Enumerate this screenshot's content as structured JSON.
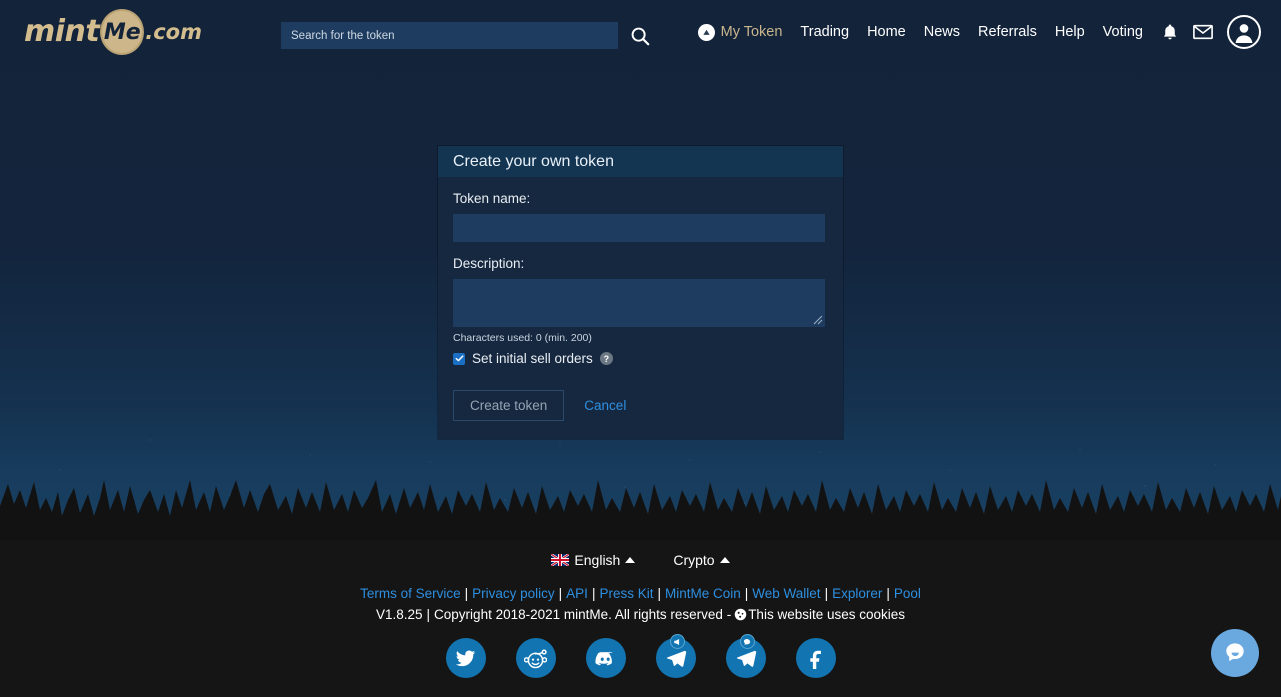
{
  "brand": {
    "logo_prefix": "mint",
    "logo_coin": "Me",
    "logo_suffix": ".com",
    "accent_gold": "#d3bd8e",
    "accent_blue": "#2e8fe0",
    "navbar_bg": "#13233a",
    "footer_bg": "#151515"
  },
  "search": {
    "placeholder": "Search for the token",
    "value": "",
    "icon": "search-icon"
  },
  "nav": {
    "my_token": "My Token",
    "my_token_icon": "triangle-up-circle-icon",
    "links": [
      {
        "label": "Trading"
      },
      {
        "label": "Home"
      },
      {
        "label": "News"
      },
      {
        "label": "Referrals"
      },
      {
        "label": "Help"
      },
      {
        "label": "Voting"
      }
    ],
    "icons": [
      {
        "name": "bell-icon"
      },
      {
        "name": "envelope-icon"
      },
      {
        "name": "avatar-icon"
      }
    ]
  },
  "card": {
    "title": "Create your own token",
    "token_name_label": "Token name:",
    "token_name_value": "",
    "token_name_placeholder": "",
    "description_label": "Description:",
    "description_value": "",
    "description_placeholder": "",
    "char_count": "Characters used: 0 (min. 200)",
    "checkbox_label": "Set initial sell orders",
    "checkbox_checked": true,
    "help_icon_label": "?",
    "create_button": "Create token",
    "cancel_link": "Cancel"
  },
  "footer": {
    "language": "English",
    "language_flag": "uk-flag-icon",
    "currency": "Crypto",
    "links": [
      {
        "label": "Terms of Service"
      },
      {
        "label": "Privacy policy"
      },
      {
        "label": "API"
      },
      {
        "label": "Press Kit"
      },
      {
        "label": "MintMe Coin"
      },
      {
        "label": "Web Wallet"
      },
      {
        "label": "Explorer"
      },
      {
        "label": "Pool"
      }
    ],
    "separator": "|",
    "version": "V1.8.25",
    "copyright": "Copyright 2018-2021 mintMe. All rights reserved -",
    "cookie_text": "This website uses cookies",
    "cookie_icon": "cookie-icon",
    "social": [
      {
        "name": "twitter-icon"
      },
      {
        "name": "reddit-icon"
      },
      {
        "name": "discord-icon"
      },
      {
        "name": "telegram-announcements-icon"
      },
      {
        "name": "telegram-chat-icon"
      },
      {
        "name": "facebook-icon"
      }
    ]
  },
  "widgets": {
    "chat_icon": "chat-bubble-icon"
  }
}
